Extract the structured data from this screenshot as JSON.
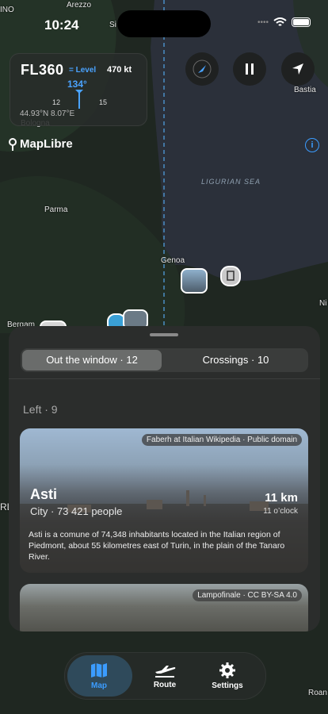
{
  "status_bar": {
    "time": "10:24"
  },
  "map": {
    "labels": {
      "arezzo": "Arezzo",
      "siena": "Si",
      "bastia": "Bastia",
      "bologna": "Bologna",
      "parma": "Parma",
      "genoa": "Genoa",
      "bergamo": "Bergam",
      "nice": "Ni",
      "roan": "Roan",
      "left_edge": "INO",
      "rl": "RL"
    },
    "sea_label": "LIGURIAN SEA"
  },
  "flight_panel": {
    "flight_level": "FL360",
    "level_label": "= Level",
    "speed": "470 kt",
    "heading": "134°",
    "tick_left": "12",
    "tick_right": "15",
    "coordinates": "44.93°N 8.07°E"
  },
  "brand": {
    "name": "MapLibre"
  },
  "sheet": {
    "tabs": [
      "Out the window · 12",
      "Crossings · 10"
    ],
    "section_title": "Left · 9",
    "cards": [
      {
        "credit": "Faberh at Italian Wikipedia · Public domain",
        "name": "Asti",
        "meta": "City · 73 421 people",
        "distance": "11 km",
        "clock": "11 o’clock",
        "description": "Asti is a comune of 74,348 inhabitants located in the Italian region of Piedmont, about 55 kilometres east of Turin, in the plain of the Tanaro River."
      },
      {
        "credit": "Lampofinale · CC BY-SA 4.0"
      }
    ]
  },
  "tabbar": {
    "map": "Map",
    "route": "Route",
    "settings": "Settings"
  },
  "colors": {
    "accent": "#4aa3ff",
    "map_land": "#1f2a22",
    "sea": "#2a2f38"
  },
  "icons": [
    "compass-icon",
    "pause-icon",
    "location-arrow-icon",
    "info-icon",
    "map-icon",
    "airplane-icon",
    "gear-icon"
  ]
}
